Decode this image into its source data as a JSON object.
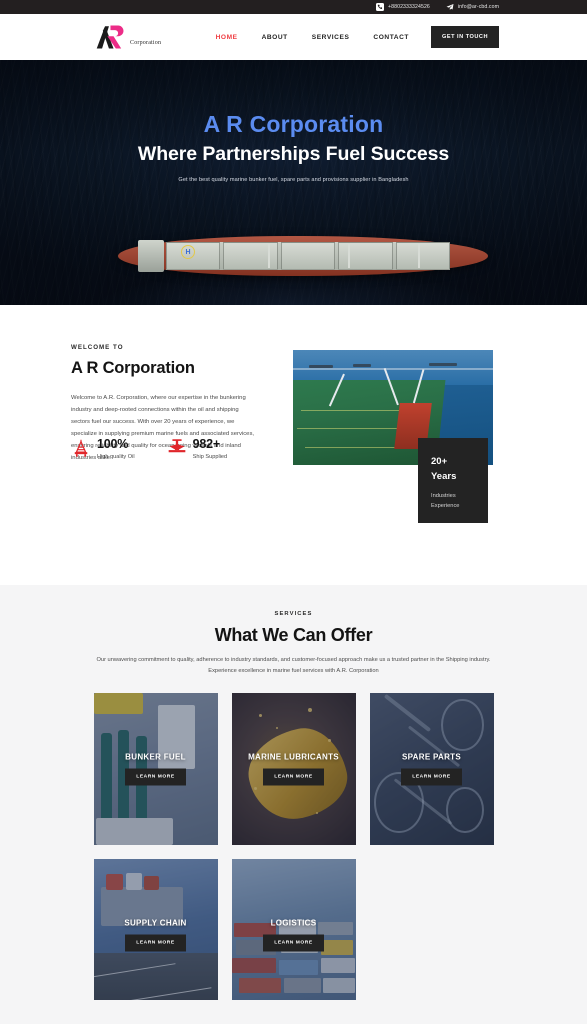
{
  "topbar": {
    "phone": "+8802333324526",
    "email": "info@ar-cbd.com",
    "phone_icon": "phone-icon",
    "email_icon": "paper-plane-icon"
  },
  "header": {
    "logo_mark": "ar-monogram-logo",
    "logo_word": "Corporation",
    "nav": [
      {
        "label": "HOME",
        "active": true
      },
      {
        "label": "ABOUT",
        "active": false
      },
      {
        "label": "SERVICES",
        "active": false
      },
      {
        "label": "CONTACT",
        "active": false
      }
    ],
    "cta_label": "GET IN TOUCH",
    "accent_color": "#ef3d42"
  },
  "hero": {
    "title": "A R Corporation",
    "subtitle": "Where Partnerships Fuel Success",
    "description": "Get the best quality marine bunker fuel, spare parts and provisions supplier in Bangladesh",
    "title_color": "#5b8cf0",
    "background_image": "aerial-cargo-ship-on-dark-ocean"
  },
  "about": {
    "eyebrow": "WELCOME TO",
    "heading": "A R Corporation",
    "paragraph": "Welcome to A.R. Corporation, where our expertise in the bunkering industry and deep-rooted connections within the oil and shipping sectors fuel our success. With over 20 years of experience, we specialize in supplying premium marine fuels and associated services, ensuring reliability and quality for ocean-going vessels and inland industries alike.",
    "stats": [
      {
        "value": "100%",
        "label": "High quality Oil",
        "icon": "oil-rig-icon"
      },
      {
        "value": "982+",
        "label": "Ship Supplied",
        "icon": "valve-icon"
      }
    ],
    "image": "green-tanker-deck-with-cranes",
    "badge": {
      "number": "20+",
      "unit": "Years",
      "caption_line1": "Industries",
      "caption_line2": "Experience"
    },
    "icon_color": "#e0262b"
  },
  "services": {
    "eyebrow": "SERVICES",
    "heading": "What We Can Offer",
    "description": "Our unwavering commitment to quality, adherence to industry standards, and customer-focused approach make us a trusted partner in the Shipping industry. Experience excellence in marine fuel services with A.R. Corporation",
    "cards": [
      {
        "title": "BUNKER FUEL",
        "button": "LEARN MORE",
        "art": "fuel-pump-photo"
      },
      {
        "title": "MARINE LUBRICANTS",
        "button": "LEARN MORE",
        "art": "flowing-oil-photo"
      },
      {
        "title": "SPARE PARTS",
        "button": "LEARN MORE",
        "art": "machine-gears-photo"
      },
      {
        "title": "SUPPLY CHAIN",
        "button": "LEARN MORE",
        "art": "cargo-ship-highway-photo"
      },
      {
        "title": "LOGISTICS",
        "button": "LEARN MORE",
        "art": "shipping-containers-photo"
      }
    ],
    "background_color": "#f5f5f6"
  }
}
